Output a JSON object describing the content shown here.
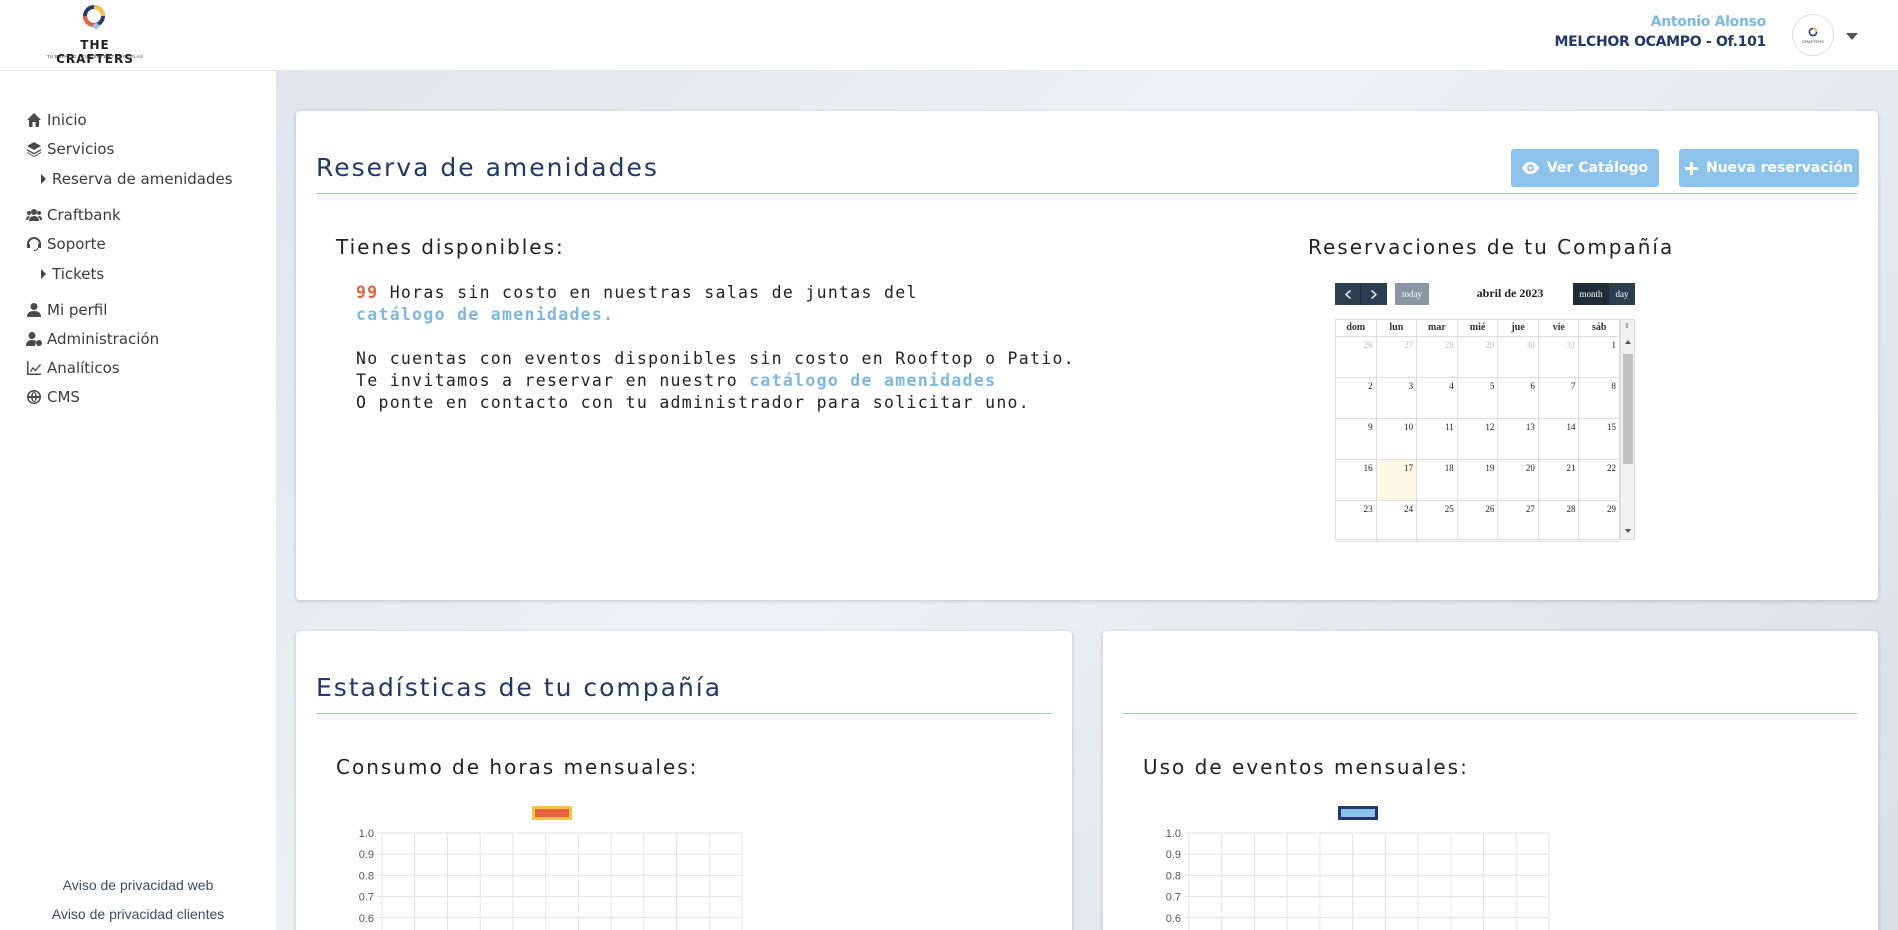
{
  "header": {
    "logo": {
      "wordmark": "THE CRAFTERS",
      "tagline": "TU ESPACIO  •  TU GENTE  •  TUS REGLAS"
    },
    "user_name": "Antonio Alonso",
    "office": "MELCHOR OCAMPO - Of.101",
    "avatar_text": "CRAFTERS"
  },
  "sidebar": {
    "items": [
      {
        "label": "Inicio",
        "icon": "home-icon"
      },
      {
        "label": "Servicios",
        "icon": "layers-icon"
      },
      {
        "label": "Reserva de amenidades",
        "sub": true
      },
      {
        "label": "Craftbank",
        "icon": "users-icon"
      },
      {
        "label": "Soporte",
        "icon": "headset-icon"
      },
      {
        "label": "Tickets",
        "sub": true
      },
      {
        "label": "Mi perfil",
        "icon": "user-icon"
      },
      {
        "label": "Administración",
        "icon": "user-gear-icon"
      },
      {
        "label": "Analíticos",
        "icon": "chart-line-icon"
      },
      {
        "label": "CMS",
        "icon": "globe-icon"
      }
    ],
    "footer_links": [
      "Aviso de privacidad web",
      "Aviso de privacidad clientes"
    ]
  },
  "reserva": {
    "title": "Reserva de amenidades",
    "btn_catalog": "Ver Catálogo",
    "btn_new": "Nueva reservación",
    "available_heading": "Tienes disponibles:",
    "hours_count": "99",
    "hours_text": " Horas sin costo en nuestras salas de juntas del ",
    "catalog_link_1": "catálogo de amenidades.",
    "events_line1": "No cuentas con eventos disponibles sin costo en Rooftop o Patio.",
    "events_line2": "Te invitamos a reservar en nuestro ",
    "catalog_link_2": "catálogo de amenidades",
    "events_line3": "O ponte en contacto con tu administrador para solicitar uno.",
    "company_heading": "Reservaciones de tu Compañía"
  },
  "calendar": {
    "today_label": "today",
    "month_label": "month",
    "day_label": "day",
    "title": "abril de 2023",
    "weekdays": [
      "dom",
      "lun",
      "mar",
      "mié",
      "jue",
      "vie",
      "sáb"
    ],
    "weeks": [
      [
        "26",
        "27",
        "28",
        "29",
        "30",
        "31",
        "1"
      ],
      [
        "2",
        "3",
        "4",
        "5",
        "6",
        "7",
        "8"
      ],
      [
        "9",
        "10",
        "11",
        "12",
        "13",
        "14",
        "15"
      ],
      [
        "16",
        "17",
        "18",
        "19",
        "20",
        "21",
        "22"
      ],
      [
        "23",
        "24",
        "25",
        "26",
        "27",
        "28",
        "29"
      ]
    ],
    "today": "17"
  },
  "stats": {
    "title": "Estadísticas de tu compañía",
    "hours_heading": "Consumo de horas mensuales:",
    "events_heading": "Uso de eventos mensuales:"
  },
  "chart_data": [
    {
      "type": "bar",
      "title": "",
      "y_ticks": [
        "1.0",
        "0.9",
        "0.8",
        "0.7",
        "0.6"
      ],
      "legend_color": "#e8613c",
      "legend_border": "#f5c342",
      "grid": true
    },
    {
      "type": "bar",
      "title": "",
      "y_ticks": [
        "1.0",
        "0.9",
        "0.8",
        "0.7",
        "0.6"
      ],
      "legend_color": "#8cc3ec",
      "legend_border": "#22386a",
      "grid": true
    }
  ]
}
